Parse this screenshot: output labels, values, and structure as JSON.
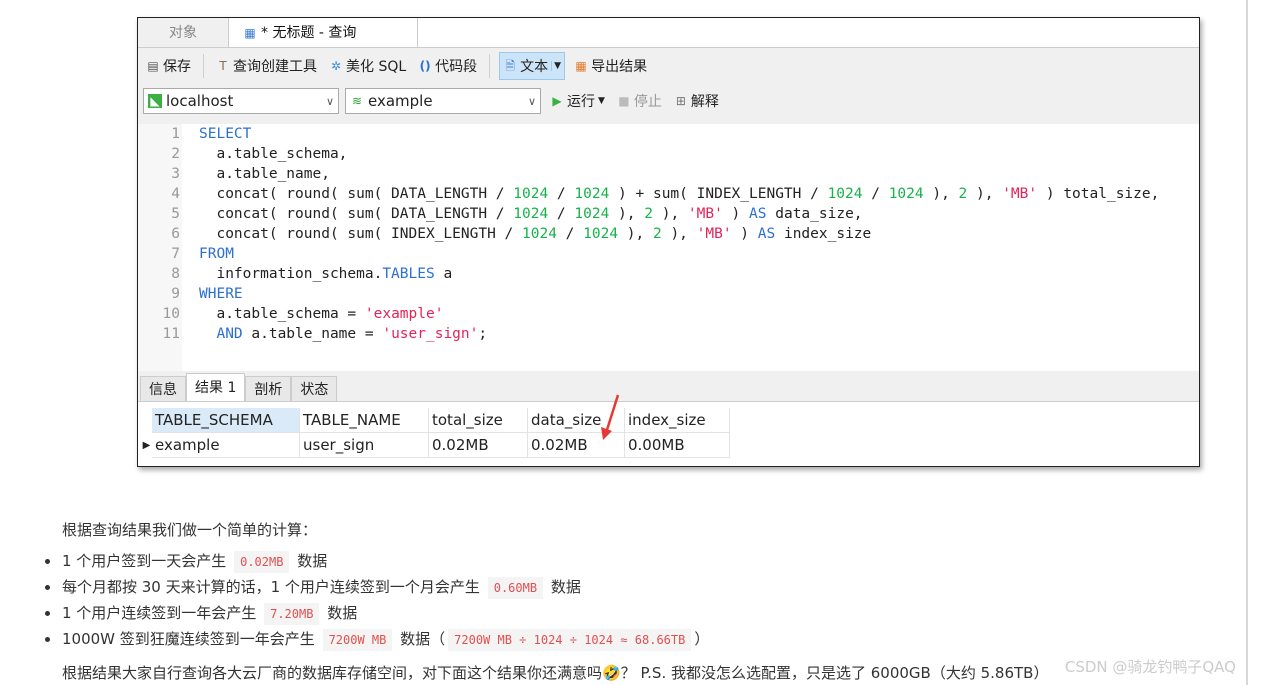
{
  "window": {
    "tabs": [
      {
        "label": "对象"
      },
      {
        "label": "* 无标题 - 查询",
        "icon": "table-icon"
      }
    ]
  },
  "toolbar": {
    "save": "保存",
    "query_builder": "查询创建工具",
    "beautify": "美化 SQL",
    "snippet": "代码段",
    "text": "文本",
    "export": "导出结果"
  },
  "connection": {
    "server": "localhost",
    "database": "example",
    "run": "运行",
    "stop": "停止",
    "explain": "解释"
  },
  "editor": {
    "lines": [
      [
        [
          "kw",
          "SELECT"
        ]
      ],
      [
        [
          "",
          "  a.table_schema,"
        ]
      ],
      [
        [
          "",
          "  a.table_name,"
        ]
      ],
      [
        [
          "",
          "  concat( round( sum( DATA_LENGTH / "
        ],
        [
          "num",
          "1024"
        ],
        [
          "",
          " / "
        ],
        [
          "num",
          "1024"
        ],
        [
          "",
          " ) + sum( INDEX_LENGTH / "
        ],
        [
          "num",
          "1024"
        ],
        [
          "",
          " / "
        ],
        [
          "num",
          "1024"
        ],
        [
          "",
          " ), "
        ],
        [
          "num",
          "2"
        ],
        [
          "",
          " ), "
        ],
        [
          "str",
          "'MB'"
        ],
        [
          "",
          " ) total_size,"
        ]
      ],
      [
        [
          "",
          "  concat( round( sum( DATA_LENGTH / "
        ],
        [
          "num",
          "1024"
        ],
        [
          "",
          " / "
        ],
        [
          "num",
          "1024"
        ],
        [
          "",
          " ), "
        ],
        [
          "num",
          "2"
        ],
        [
          "",
          " ), "
        ],
        [
          "str",
          "'MB'"
        ],
        [
          "",
          " ) "
        ],
        [
          "kw",
          "AS"
        ],
        [
          "",
          " data_size,"
        ]
      ],
      [
        [
          "",
          "  concat( round( sum( INDEX_LENGTH / "
        ],
        [
          "num",
          "1024"
        ],
        [
          "",
          " / "
        ],
        [
          "num",
          "1024"
        ],
        [
          "",
          " ), "
        ],
        [
          "num",
          "2"
        ],
        [
          "",
          " ), "
        ],
        [
          "str",
          "'MB'"
        ],
        [
          "",
          " ) "
        ],
        [
          "kw",
          "AS"
        ],
        [
          "",
          " index_size"
        ]
      ],
      [
        [
          "kw",
          "FROM"
        ]
      ],
      [
        [
          "",
          "  information_schema."
        ],
        [
          "kw",
          "TABLES"
        ],
        [
          "",
          " a"
        ]
      ],
      [
        [
          "kw",
          "WHERE"
        ]
      ],
      [
        [
          "",
          "  a.table_schema = "
        ],
        [
          "str",
          "'example'"
        ]
      ],
      [
        [
          "kw",
          "  AND"
        ],
        [
          "",
          " a.table_name = "
        ],
        [
          "str",
          "'user_sign'"
        ],
        [
          "",
          ";"
        ]
      ]
    ]
  },
  "result_tabs": [
    "信息",
    "结果 1",
    "剖析",
    "状态"
  ],
  "grid": {
    "columns": [
      "TABLE_SCHEMA",
      "TABLE_NAME",
      "total_size",
      "data_size",
      "index_size"
    ],
    "rows": [
      [
        "example",
        "user_sign",
        "0.02MB",
        "0.02MB",
        "0.00MB"
      ]
    ]
  },
  "article": {
    "intro": "根据查询结果我们做一个简单的计算：",
    "bullets": [
      {
        "pre": "1 个用户签到一天会产生",
        "code": "0.02MB",
        "post": "数据"
      },
      {
        "pre": "每个月都按 30 天来计算的话，1 个用户连续签到一个月会产生",
        "code": "0.60MB",
        "post": "数据"
      },
      {
        "pre": "1 个用户连续签到一年会产生",
        "code": "7.20MB",
        "post": "数据"
      },
      {
        "pre": "1000W 签到狂魔连续签到一年会产生",
        "code": "7200W MB",
        "post": "数据（",
        "code2": "7200W MB ÷ 1024 ÷ 1024 ≈ 68.66TB",
        "post2": "）"
      }
    ],
    "outro": "根据结果大家自行查询各大云厂商的数据库存储空间，对下面这个结果你还满意吗🤣？ P.S. 我都没怎么选配置，只是选了 6000GB（大约 5.86TB）",
    "watermark": "CSDN @骑龙钓鸭子QAQ"
  },
  "colors": {
    "keyword": "#2b6fd6",
    "number": "#17b24a",
    "string": "#e2245b",
    "inline_code": "#e24f4f",
    "arrow": "#e53935"
  }
}
